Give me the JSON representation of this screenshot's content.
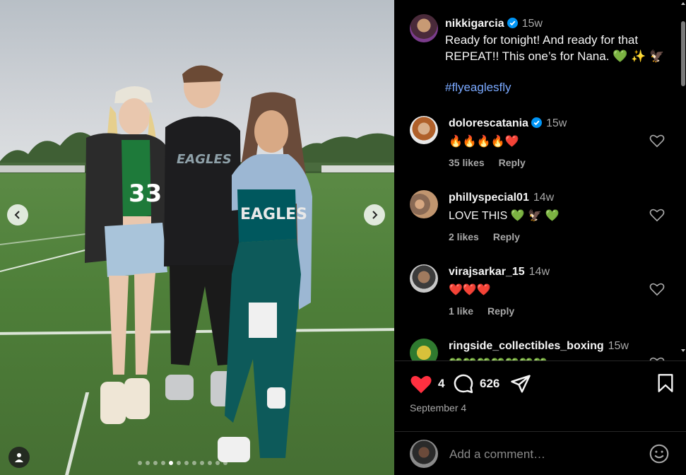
{
  "post": {
    "author": "nikkigarcia",
    "time": "15w",
    "caption": "Ready for tonight! And ready for that REPEAT!! This one’s for Nana. 💚 ✨ 🦅",
    "hashtag": "#flyeaglesfly"
  },
  "photo": {
    "shirt_text": "EAGLES",
    "top_text": "EAGLES",
    "jersey_number": "33",
    "dots_total": 12,
    "dots_active_index": 4
  },
  "comments": [
    {
      "user": "dolorescatania",
      "verified": true,
      "time": "15w",
      "text": "🔥🔥🔥🔥❤️",
      "likes": "35 likes",
      "reply": "Reply"
    },
    {
      "user": "phillyspecial01",
      "verified": false,
      "time": "14w",
      "text": "LOVE THIS 💚 🦅 💚",
      "likes": "2 likes",
      "reply": "Reply"
    },
    {
      "user": "virajsarkar_15",
      "verified": false,
      "time": "14w",
      "text": "❤️❤️❤️",
      "likes": "1 like",
      "reply": "Reply"
    },
    {
      "user": "ringside_collectibles_boxing",
      "verified": false,
      "time": "15w",
      "text": "💚💚💚💚💚💚💚",
      "likes": "",
      "reply": ""
    }
  ],
  "actions": {
    "likes_count": "4",
    "comments_count": "626",
    "date": "September 4"
  },
  "add_comment": {
    "placeholder": "Add a comment…"
  },
  "colors": {
    "like_red": "#ff3040",
    "link_blue": "#7aa9ff",
    "verified_blue": "#0095f6",
    "eagles_green": "#004c54"
  },
  "icons": [
    "chevron-left-icon",
    "chevron-right-icon",
    "user-tag-icon",
    "heart-icon",
    "comment-icon",
    "share-icon",
    "bookmark-icon",
    "emoji-icon",
    "verified-badge-icon"
  ]
}
